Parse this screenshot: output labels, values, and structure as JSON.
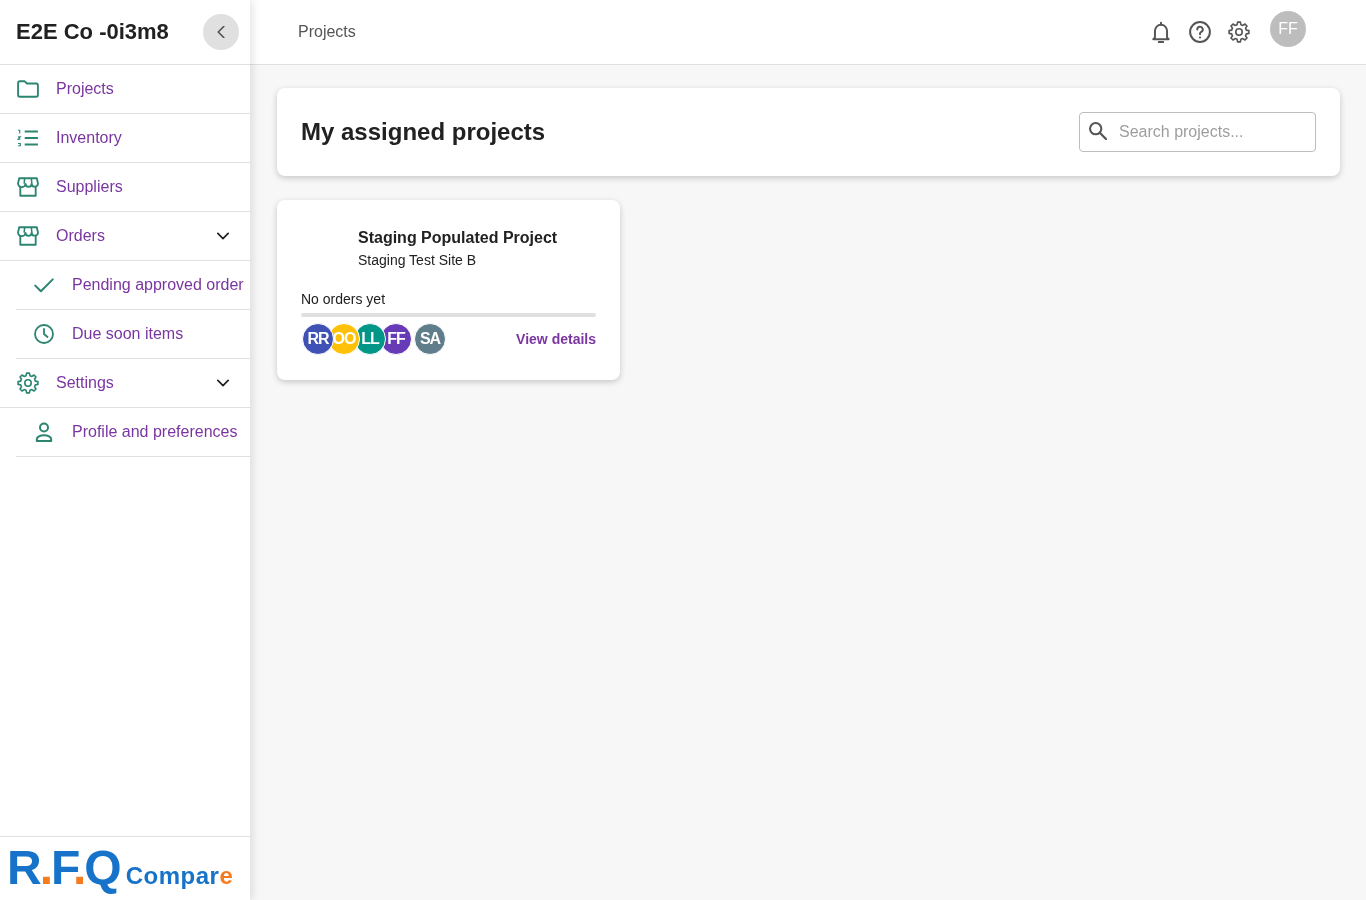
{
  "sidebar": {
    "title": "E2E Co -0i3m8",
    "items": [
      {
        "label": "Projects"
      },
      {
        "label": "Inventory"
      },
      {
        "label": "Suppliers"
      },
      {
        "label": "Orders",
        "expanded": true,
        "children": [
          {
            "label": "Pending approved order"
          },
          {
            "label": "Due soon items"
          }
        ]
      },
      {
        "label": "Settings",
        "expanded": true,
        "children": [
          {
            "label": "Profile and preferences"
          }
        ]
      }
    ],
    "logo": {
      "mark": [
        {
          "text": "R",
          "color": "#1673c9"
        },
        {
          "text": ".",
          "color": "#f47b20"
        },
        {
          "text": "F",
          "color": "#1673c9"
        },
        {
          "text": ".",
          "color": "#f47b20"
        },
        {
          "text": "Q",
          "color": "#1673c9"
        }
      ],
      "word": [
        {
          "text": "Compar",
          "color": "#1673c9"
        },
        {
          "text": "e",
          "color": "#f47b20"
        }
      ]
    }
  },
  "topbar": {
    "breadcrumb": "Projects",
    "user_initials": "FF"
  },
  "header": {
    "title": "My assigned projects",
    "search": {
      "placeholder": "Search projects..."
    }
  },
  "projects": [
    {
      "name": "Staging Populated Project",
      "site": "Staging Test Site B",
      "orders_status": "No orders yet",
      "member_groups": [
        {
          "members": [
            {
              "initials": "RR",
              "color": "#3f51b5"
            },
            {
              "initials": "OO",
              "color": "#ffc107"
            },
            {
              "initials": "LL",
              "color": "#009688"
            },
            {
              "initials": "FF",
              "color": "#673ab7"
            }
          ]
        },
        {
          "members": [
            {
              "initials": "SA",
              "color": "#607d8b"
            }
          ]
        }
      ],
      "action": "View details"
    }
  ]
}
